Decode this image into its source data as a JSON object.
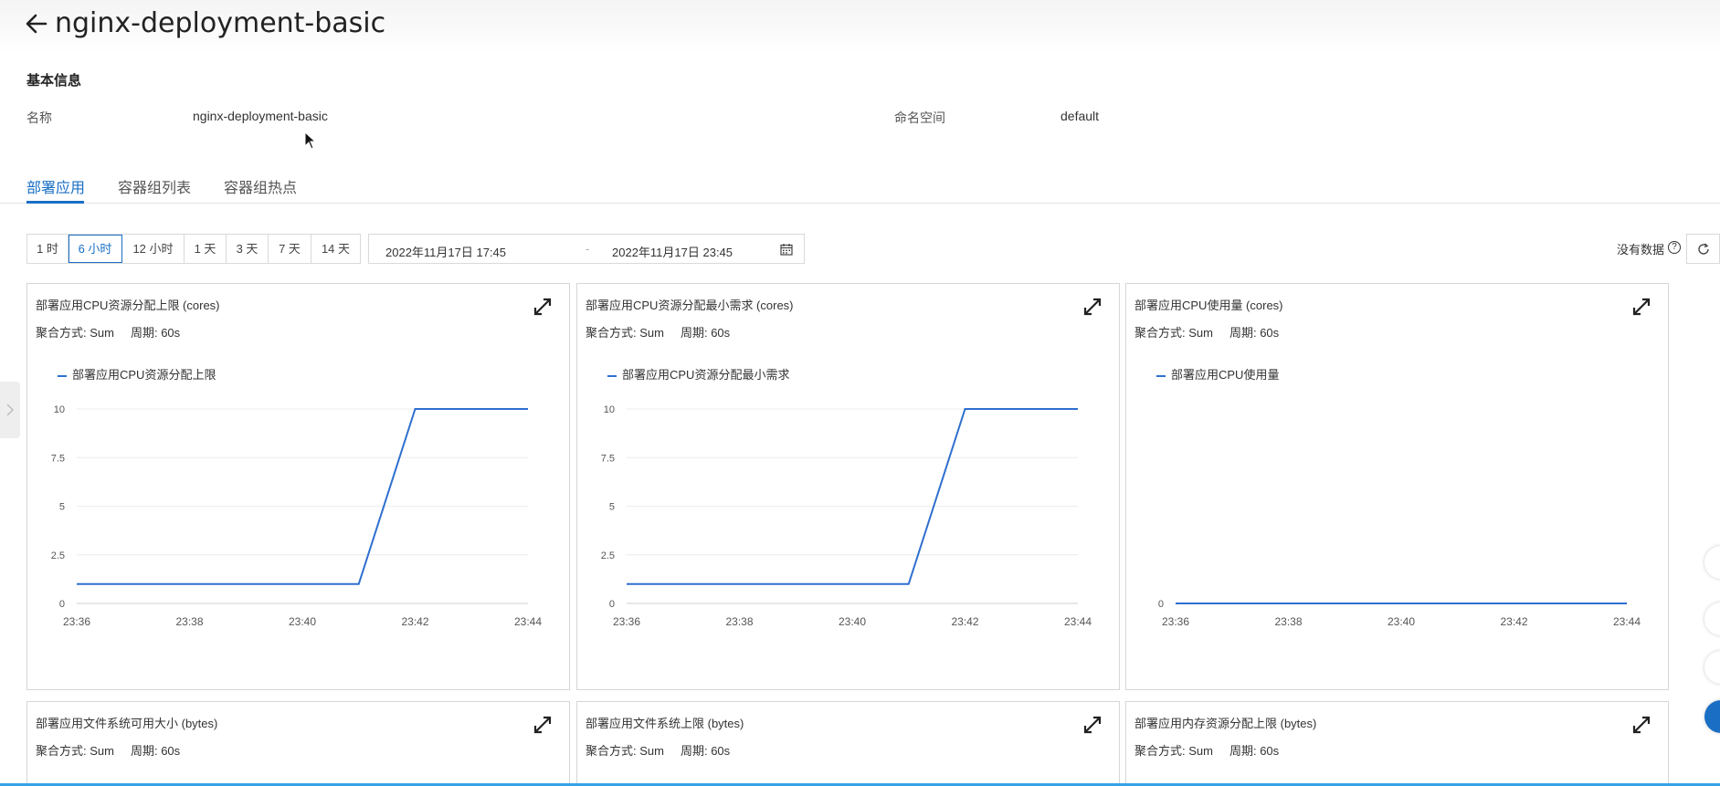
{
  "header": {
    "title": "nginx-deployment-basic"
  },
  "basic_info": {
    "section_title": "基本信息",
    "name_label": "名称",
    "name_value": "nginx-deployment-basic",
    "namespace_label": "命名空间",
    "namespace_value": "default"
  },
  "tabs": [
    {
      "label": "部署应用",
      "active": true
    },
    {
      "label": "容器组列表",
      "active": false
    },
    {
      "label": "容器组热点",
      "active": false
    }
  ],
  "time_ranges": [
    {
      "label": "1 时",
      "active": false
    },
    {
      "label": "6 小时",
      "active": true
    },
    {
      "label": "12 小时",
      "active": false
    },
    {
      "label": "1 天",
      "active": false
    },
    {
      "label": "3 天",
      "active": false
    },
    {
      "label": "7 天",
      "active": false
    },
    {
      "label": "14 天",
      "active": false
    }
  ],
  "date_range": {
    "start": "2022年11月17日 17:45",
    "separator": "-",
    "end": "2022年11月17日 23:45"
  },
  "toolbar": {
    "no_data_label": "没有数据",
    "help_glyph": "?"
  },
  "colors": {
    "accent": "#1a6fc4",
    "series": "#2f6fcf",
    "progress": "#36a3e8"
  },
  "icons": [
    "back-arrow-icon",
    "calendar-icon",
    "help-icon",
    "refresh-icon",
    "expand-icon",
    "cursor-icon"
  ],
  "cards": [
    {
      "title": "部署应用CPU资源分配上限 (cores)",
      "aggregation": "聚合方式: Sum",
      "period": "周期: 60s",
      "legend": "部署应用CPU资源分配上限"
    },
    {
      "title": "部署应用CPU资源分配最小需求 (cores)",
      "aggregation": "聚合方式: Sum",
      "period": "周期: 60s",
      "legend": "部署应用CPU资源分配最小需求"
    },
    {
      "title": "部署应用CPU使用量 (cores)",
      "aggregation": "聚合方式: Sum",
      "period": "周期: 60s",
      "legend": "部署应用CPU使用量"
    },
    {
      "title": "部署应用文件系统可用大小 (bytes)",
      "aggregation": "聚合方式: Sum",
      "period": "周期: 60s"
    },
    {
      "title": "部署应用文件系统上限 (bytes)",
      "aggregation": "聚合方式: Sum",
      "period": "周期: 60s"
    },
    {
      "title": "部署应用内存资源分配上限 (bytes)",
      "aggregation": "聚合方式: Sum",
      "period": "周期: 60s"
    }
  ],
  "chart_data": [
    {
      "type": "line",
      "title": "部署应用CPU资源分配上限 (cores)",
      "x": [
        "23:36",
        "23:37",
        "23:38",
        "23:39",
        "23:40",
        "23:41",
        "23:42",
        "23:43",
        "23:44"
      ],
      "x_ticks": [
        "23:36",
        "23:38",
        "23:40",
        "23:42",
        "23:44"
      ],
      "y_ticks": [
        "10",
        "7.5",
        "5",
        "2.5",
        "0"
      ],
      "ylim": [
        0,
        10
      ],
      "grid": true,
      "legend": "top-left",
      "series": [
        {
          "name": "部署应用CPU资源分配上限",
          "values": [
            1,
            1,
            1,
            1,
            1,
            1,
            10,
            10,
            10
          ]
        }
      ]
    },
    {
      "type": "line",
      "title": "部署应用CPU资源分配最小需求 (cores)",
      "x": [
        "23:36",
        "23:37",
        "23:38",
        "23:39",
        "23:40",
        "23:41",
        "23:42",
        "23:43",
        "23:44"
      ],
      "x_ticks": [
        "23:36",
        "23:38",
        "23:40",
        "23:42",
        "23:44"
      ],
      "y_ticks": [
        "10",
        "7.5",
        "5",
        "2.5",
        "0"
      ],
      "ylim": [
        0,
        10
      ],
      "grid": true,
      "legend": "top-left",
      "series": [
        {
          "name": "部署应用CPU资源分配最小需求",
          "values": [
            1,
            1,
            1,
            1,
            1,
            1,
            10,
            10,
            10
          ]
        }
      ]
    },
    {
      "type": "line",
      "title": "部署应用CPU使用量 (cores)",
      "x": [
        "23:36",
        "23:37",
        "23:38",
        "23:39",
        "23:40",
        "23:41",
        "23:42",
        "23:43",
        "23:44"
      ],
      "x_ticks": [
        "23:36",
        "23:38",
        "23:40",
        "23:42",
        "23:44"
      ],
      "y_ticks": [
        "0"
      ],
      "ylim": [
        0,
        1
      ],
      "grid": true,
      "legend": "top-left",
      "series": [
        {
          "name": "部署应用CPU使用量",
          "values": [
            0,
            0,
            0,
            0,
            0,
            0,
            0,
            0,
            0
          ]
        }
      ]
    }
  ]
}
